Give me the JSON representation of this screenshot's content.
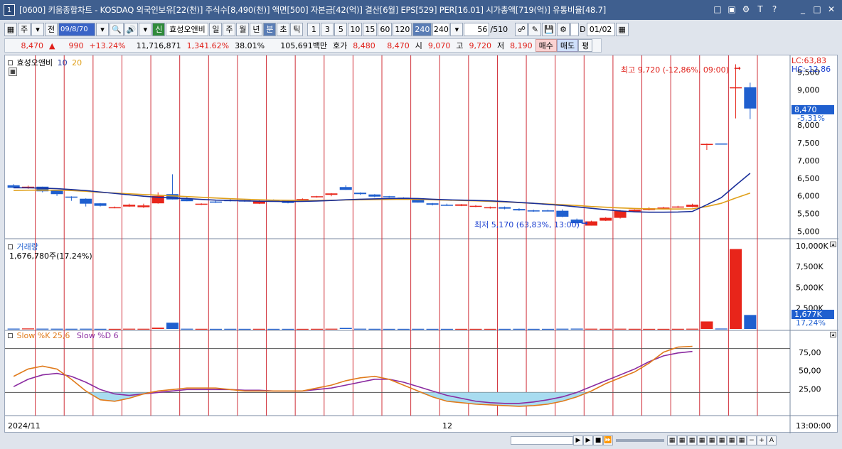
{
  "window": {
    "number": "1",
    "title": "[0600] 키움종합차트 - KOSDAQ 외국인보유[22(천)] 주식수[8,490(천)] 액면[500] 자본금[42(억)] 결산[6월] EPS[529] PER[16.01] 시가총액[719(억)] 유통비율[48.7]"
  },
  "toolbar": {
    "period_day": "주",
    "period_prev": "전",
    "date_value": "09/8/70",
    "stock_tag": "신",
    "stock_name": "효성오앤비",
    "intervals": [
      "일",
      "주",
      "월",
      "년",
      "분",
      "초",
      "틱"
    ],
    "selected_interval": "분",
    "minutes": [
      "1",
      "3",
      "5",
      "10",
      "15",
      "60",
      "120",
      "240"
    ],
    "selected_minute": "240",
    "minute_combo": "240",
    "count_value": "56",
    "count_total": "/510",
    "d_label": "D",
    "date_field": "01/02"
  },
  "quote": {
    "price": "8,470",
    "change": "990",
    "change_pct": "+13.24%",
    "volume": "11,716,871",
    "volume_ratio": "1,341.62%",
    "turnover": "38.01%",
    "amount": "105,691백만",
    "hoga_label": "호가",
    "hoga1": "8,480",
    "hoga2": "8,470",
    "open_label": "시",
    "open": "9,070",
    "high_label": "고",
    "high": "9,720",
    "low_label": "저",
    "low": "8,190",
    "buy_label": "매수",
    "sell_label": "매도",
    "eval_label": "평"
  },
  "chart_legend": {
    "stock": "효성오앤비",
    "ma1": "10",
    "ma2": "20",
    "volume_title": "거래량",
    "volume_value": "1,676,780주(17.24%)",
    "stoch_k": "Slow %K 25,6",
    "stoch_d": "Slow %D 6",
    "max_annot": "최고 9,720 (-12,86%, 09:00)",
    "min_annot": "최저 5,170 (63,83%, 13:00)",
    "lc": "LC:63,83",
    "hc": "HC:-12,86",
    "cur_price": "8,470",
    "cur_pct": "-5,31%",
    "cur_vol": "1,677K",
    "cur_vol_pct": "17,24%",
    "x_start": "2024/11",
    "x_mid": "12",
    "x_end": "13:00:00"
  },
  "colors": {
    "up": "#e8251a",
    "down": "#1f5fcf",
    "ma10": "#1a2f9a",
    "ma20": "#e0a01a",
    "stochK": "#e07a1a",
    "stochD": "#8a2aa0",
    "vgrid": "#d0303a"
  },
  "chart_data": {
    "type": "candlestick",
    "price_axis": [
      5000,
      5500,
      6000,
      6500,
      7000,
      7500,
      8000,
      9000
    ],
    "price_axis_labels": [
      "5,000",
      "5,500",
      "6,000",
      "6,500",
      "7,000",
      "7,500",
      "8,000",
      "9,000",
      "9,500"
    ],
    "volume_axis_labels": [
      "10,000K",
      "7,500K",
      "5,000K",
      "2,500K"
    ],
    "stoch_axis_labels": [
      "75,00",
      "50,00",
      "25,00"
    ],
    "candles": [
      [
        6300,
        6330,
        6220,
        6230
      ],
      [
        6230,
        6290,
        6200,
        6260
      ],
      [
        6260,
        6260,
        6100,
        6130
      ],
      [
        6150,
        6160,
        6000,
        6050
      ],
      [
        5980,
        5990,
        5860,
        5960
      ],
      [
        5920,
        5930,
        5700,
        5780
      ],
      [
        5790,
        5800,
        5700,
        5720
      ],
      [
        5670,
        5700,
        5650,
        5680
      ],
      [
        5700,
        5780,
        5690,
        5750
      ],
      [
        5680,
        5780,
        5660,
        5730
      ],
      [
        5790,
        6100,
        5780,
        6000
      ],
      [
        6050,
        6610,
        5900,
        5900
      ],
      [
        5910,
        5960,
        5850,
        5850
      ],
      [
        5750,
        5790,
        5740,
        5780
      ],
      [
        5840,
        5860,
        5800,
        5810
      ],
      [
        5880,
        5910,
        5840,
        5860
      ],
      [
        5880,
        5890,
        5830,
        5840
      ],
      [
        5780,
        5880,
        5770,
        5860
      ],
      [
        5880,
        5900,
        5840,
        5860
      ],
      [
        5860,
        5880,
        5790,
        5800
      ],
      [
        5900,
        5930,
        5880,
        5910
      ],
      [
        5970,
        6000,
        5950,
        5990
      ],
      [
        6030,
        6080,
        5990,
        6070
      ],
      [
        6250,
        6300,
        6170,
        6170
      ],
      [
        6090,
        6100,
        6030,
        6050
      ],
      [
        6040,
        6050,
        5960,
        5980
      ],
      [
        5990,
        6000,
        5950,
        5960
      ],
      [
        5950,
        5960,
        5900,
        5920
      ],
      [
        5900,
        5910,
        5810,
        5810
      ],
      [
        5790,
        5800,
        5730,
        5750
      ],
      [
        5750,
        5780,
        5720,
        5730
      ],
      [
        5720,
        5770,
        5710,
        5760
      ],
      [
        5700,
        5740,
        5680,
        5720
      ],
      [
        5650,
        5700,
        5640,
        5680
      ],
      [
        5680,
        5700,
        5620,
        5640
      ],
      [
        5630,
        5650,
        5580,
        5590
      ],
      [
        5590,
        5610,
        5550,
        5580
      ],
      [
        5590,
        5610,
        5560,
        5570
      ],
      [
        5580,
        5620,
        5400,
        5410
      ],
      [
        5330,
        5360,
        5190,
        5230
      ],
      [
        5160,
        5300,
        5160,
        5280
      ],
      [
        5300,
        5400,
        5290,
        5380
      ],
      [
        5380,
        5600,
        5360,
        5580
      ],
      [
        5560,
        5620,
        5540,
        5610
      ],
      [
        5600,
        5680,
        5590,
        5650
      ],
      [
        5640,
        5690,
        5630,
        5670
      ],
      [
        5670,
        5720,
        5660,
        5700
      ],
      [
        5690,
        5780,
        5680,
        5750
      ],
      [
        7470,
        7480,
        7300,
        7470
      ],
      [
        7480,
        7480,
        7460,
        7470
      ],
      [
        9070,
        9720,
        8190,
        9070
      ],
      [
        9070,
        9200,
        8170,
        8470
      ]
    ],
    "volume": [
      40,
      60,
      35,
      30,
      25,
      30,
      20,
      15,
      30,
      25,
      150,
      750,
      30,
      20,
      15,
      20,
      15,
      20,
      15,
      15,
      15,
      20,
      30,
      120,
      30,
      20,
      15,
      15,
      20,
      15,
      15,
      15,
      15,
      15,
      15,
      20,
      15,
      15,
      30,
      40,
      30,
      20,
      30,
      20,
      15,
      15,
      20,
      30,
      900,
      50,
      9600,
      1677
    ],
    "ma10": [
      6230,
      6228,
      6220,
      6205,
      6180,
      6150,
      6110,
      6070,
      6030,
      5990,
      5960,
      5940,
      5925,
      5900,
      5880,
      5870,
      5860,
      5850,
      5845,
      5840,
      5845,
      5855,
      5870,
      5890,
      5905,
      5915,
      5925,
      5930,
      5925,
      5905,
      5890,
      5880,
      5870,
      5860,
      5840,
      5815,
      5790,
      5760,
      5730,
      5690,
      5650,
      5610,
      5575,
      5550,
      5540,
      5540,
      5545,
      5560,
      5750,
      5950,
      6300,
      6640
    ],
    "ma20": [
      6150,
      6160,
      6165,
      6160,
      6150,
      6130,
      6100,
      6080,
      6060,
      6040,
      6020,
      6000,
      5980,
      5960,
      5940,
      5920,
      5905,
      5890,
      5880,
      5875,
      5870,
      5870,
      5875,
      5885,
      5890,
      5895,
      5900,
      5905,
      5900,
      5890,
      5880,
      5870,
      5860,
      5845,
      5830,
      5810,
      5790,
      5770,
      5750,
      5730,
      5700,
      5680,
      5660,
      5645,
      5635,
      5630,
      5630,
      5635,
      5700,
      5790,
      5940,
      6080
    ],
    "stochK": [
      42,
      52,
      56,
      52,
      38,
      22,
      10,
      8,
      12,
      18,
      22,
      24,
      26,
      26,
      26,
      24,
      22,
      22,
      22,
      22,
      22,
      26,
      30,
      36,
      40,
      42,
      38,
      30,
      22,
      14,
      8,
      6,
      4,
      3,
      2,
      1,
      2,
      4,
      8,
      14,
      22,
      32,
      40,
      48,
      60,
      75,
      82,
      83
    ],
    "stochD": [
      28,
      38,
      44,
      46,
      42,
      34,
      24,
      18,
      16,
      18,
      20,
      22,
      24,
      24,
      24,
      24,
      23,
      23,
      22,
      22,
      22,
      24,
      26,
      30,
      34,
      38,
      38,
      34,
      28,
      22,
      16,
      12,
      8,
      6,
      5,
      5,
      7,
      10,
      14,
      20,
      28,
      36,
      44,
      52,
      62,
      70,
      74,
      76
    ],
    "xlabel": "",
    "ylabel": ""
  }
}
